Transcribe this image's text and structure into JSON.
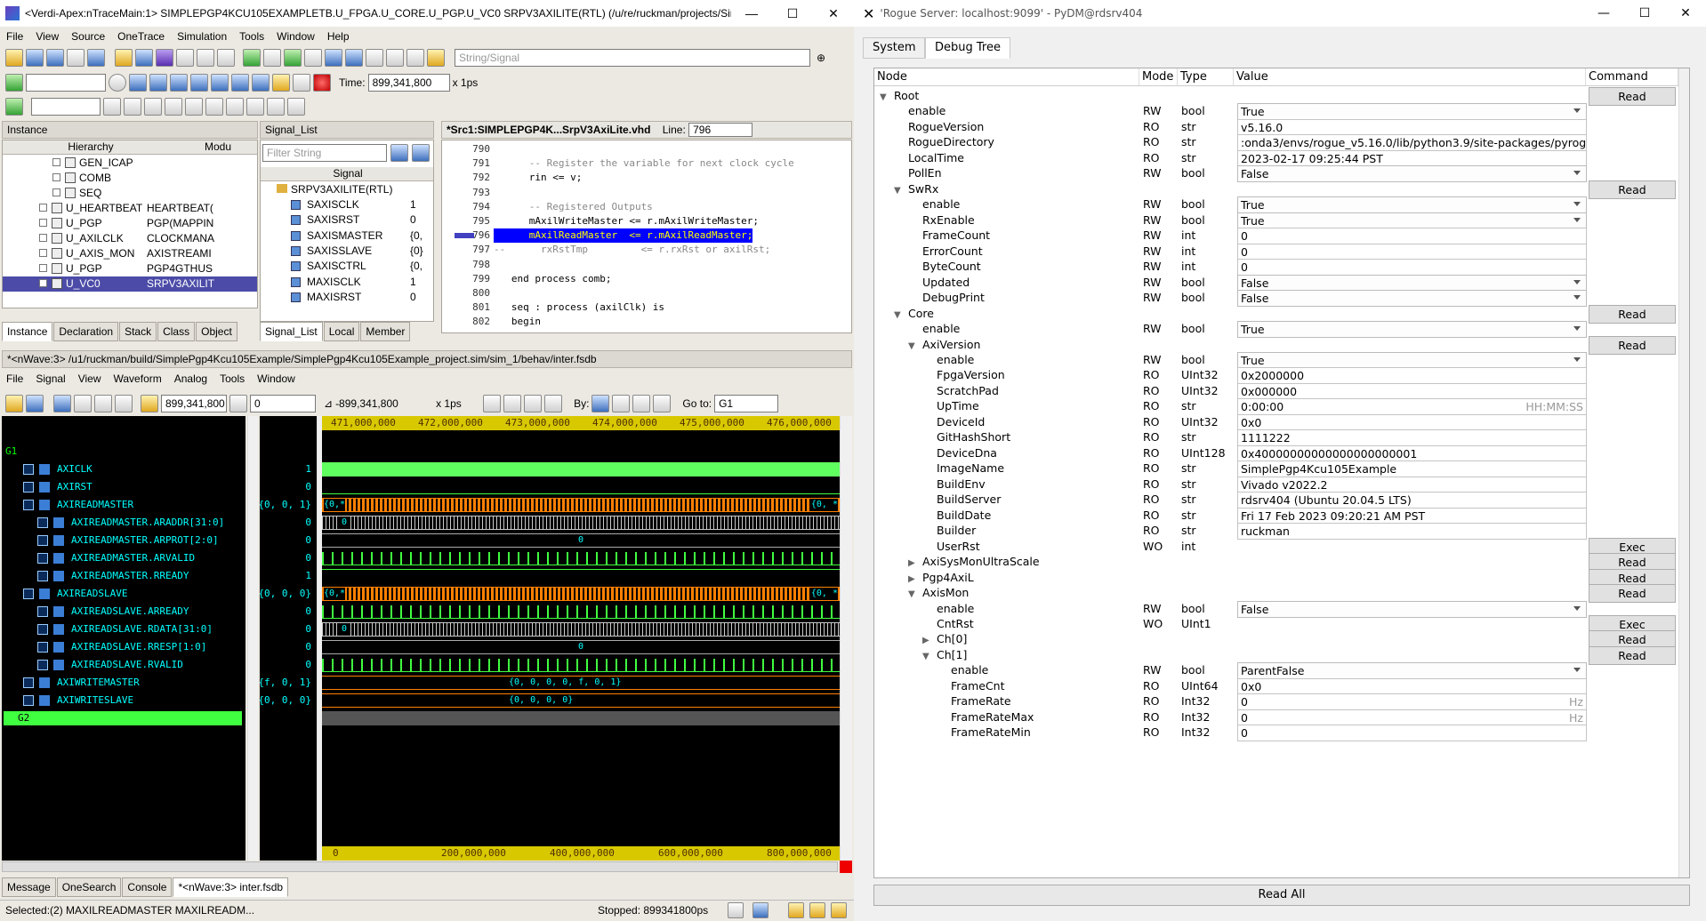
{
  "verdi": {
    "title": "<Verdi-Apex:nTraceMain:1> SIMPLEPGP4KCU105EXAMPLETB.U_FPGA.U_CORE.U_PGP.U_VC0 SRPV3AXILITE(RTL) (/u/re/ruckman/projects/Simple-P...",
    "menu": [
      "File",
      "View",
      "Source",
      "OneTrace",
      "Simulation",
      "Tools",
      "Window",
      "Help"
    ],
    "search_placeholder": "String/Signal",
    "time_label": "Time:",
    "time_value": "899,341,800",
    "time_unit": "x 1ps",
    "instance_panel": "Instance",
    "hier_col": "Hierarchy",
    "mod_col": "Modu",
    "instance_rows": [
      {
        "name": "GEN_ICAP",
        "mod": ""
      },
      {
        "name": "COMB",
        "mod": ""
      },
      {
        "name": "SEQ",
        "mod": ""
      },
      {
        "name": "U_HEARTBEAT",
        "mod": "HEARTBEAT("
      },
      {
        "name": "U_PGP",
        "mod": "PGP(MAPPIN"
      },
      {
        "name": "U_AXILCLK",
        "mod": "CLOCKMANA"
      },
      {
        "name": "U_AXIS_MON",
        "mod": "AXISTREAMI"
      },
      {
        "name": "U_PGP",
        "mod": "PGP4GTHUS"
      },
      {
        "name": "U_VC0",
        "mod": "SRPV3AXILIT"
      }
    ],
    "left_tabs": [
      "Instance",
      "Declaration",
      "Stack",
      "Class",
      "Object"
    ],
    "signal_panel": "Signal_List",
    "filter_placeholder": "Filter String",
    "signal_col": "Signal",
    "signal_root": "SRPV3AXILITE(RTL)",
    "signal_rows": [
      {
        "name": "SAXISCLK",
        "v": "1"
      },
      {
        "name": "SAXISRST",
        "v": "0"
      },
      {
        "name": "SAXISMASTER",
        "v": "{0,"
      },
      {
        "name": "SAXISSLAVE",
        "v": "{0}"
      },
      {
        "name": "SAXISCTRL",
        "v": "{0,"
      },
      {
        "name": "MAXISCLK",
        "v": "1"
      },
      {
        "name": "MAXISRST",
        "v": "0"
      }
    ],
    "signal_tabs": [
      "Signal_List",
      "Local",
      "Member"
    ],
    "src_title": "*Src1:SIMPLEPGP4K...SrpV3AxiLite.vhd",
    "line_label": "Line:",
    "line_value": "796",
    "code": [
      {
        "n": "790",
        "t": ""
      },
      {
        "n": "791",
        "t": "      -- Register the variable for next clock cycle"
      },
      {
        "n": "792",
        "t": "      rin <= v;"
      },
      {
        "n": "793",
        "t": ""
      },
      {
        "n": "794",
        "t": "      -- Registered Outputs"
      },
      {
        "n": "795",
        "t": "      mAxilWriteMaster <= r.mAxilWriteMaster;"
      },
      {
        "n": "796",
        "t": "      mAxilReadMaster  <= r.mAxilReadMaster;"
      },
      {
        "n": "797",
        "t": "--      rxRstTmp         <= r.rxRst or axilRst;"
      },
      {
        "n": "798",
        "t": ""
      },
      {
        "n": "799",
        "t": "   end process comb;"
      },
      {
        "n": "800",
        "t": ""
      },
      {
        "n": "801",
        "t": "   seq : process (axilClk) is"
      },
      {
        "n": "802",
        "t": "   begin"
      }
    ],
    "wave_title": "*<nWave:3> /u1/ruckman/build/SimplePgp4Kcu105Example/SimplePgp4Kcu105Example_project.sim/sim_1/behav/inter.fsdb",
    "wave_menu": [
      "File",
      "Signal",
      "View",
      "Waveform",
      "Analog",
      "Tools",
      "Window"
    ],
    "wave_cursor": "899,341,800",
    "wave_marker": "0",
    "wave_delta": "-899,341,800",
    "wave_unit": "x 1ps",
    "by_label": "By:",
    "goto_label": "Go to:",
    "goto_value": "G1",
    "group1": "G1",
    "group2": "G2",
    "signals": [
      {
        "name": "AXICLK",
        "val": "1",
        "sub": false
      },
      {
        "name": "AXIRST",
        "val": "0",
        "sub": false
      },
      {
        "name": "AXIREADMASTER",
        "val": "{0, 0, 1}",
        "sub": false
      },
      {
        "name": "AXIREADMASTER.ARADDR[31:0]",
        "val": "0",
        "sub": true
      },
      {
        "name": "AXIREADMASTER.ARPROT[2:0]",
        "val": "0",
        "sub": true
      },
      {
        "name": "AXIREADMASTER.ARVALID",
        "val": "0",
        "sub": true
      },
      {
        "name": "AXIREADMASTER.RREADY",
        "val": "1",
        "sub": true
      },
      {
        "name": "AXIREADSLAVE",
        "val": "{0, 0, 0}",
        "sub": false
      },
      {
        "name": "AXIREADSLAVE.ARREADY",
        "val": "0",
        "sub": true
      },
      {
        "name": "AXIREADSLAVE.RDATA[31:0]",
        "val": "0",
        "sub": true
      },
      {
        "name": "AXIREADSLAVE.RRESP[1:0]",
        "val": "0",
        "sub": true
      },
      {
        "name": "AXIREADSLAVE.RVALID",
        "val": "0",
        "sub": true
      },
      {
        "name": "AXIWRITEMASTER",
        "val": "{f, 0, 1}",
        "sub": false
      },
      {
        "name": "AXIWRITESLAVE",
        "val": "{0, 0, 0}",
        "sub": false
      }
    ],
    "wave_labels": {
      "bus1": "{0,*",
      "bus1r": "{0, *",
      "zero": "0",
      "wm": "{0, 0, 0, 0, f, 0, 1}",
      "ws": "{0, 0, 0, 0}"
    },
    "ticks_top": [
      "471,000,000",
      "472,000,000",
      "473,000,000",
      "474,000,000",
      "475,000,000",
      "476,000,000"
    ],
    "ticks_bottom": [
      "0",
      "200,000,000",
      "400,000,000",
      "600,000,000",
      "800,000,000"
    ],
    "bottom_tabs": [
      "Message",
      "OneSearch",
      "Console",
      "*<nWave:3> inter.fsdb"
    ],
    "status_left": "Selected:(2) MAXILREADMASTER MAXILREADM...",
    "status_right": "Stopped:  899341800ps"
  },
  "rogue": {
    "title": "'Rogue Server: localhost:9099' - PyDM@rdsrv404",
    "tabs": [
      "System",
      "Debug Tree"
    ],
    "cols": [
      "Node",
      "Mode",
      "Type",
      "Value",
      "Command"
    ],
    "read_all": "Read All",
    "rows": [
      {
        "ind": 0,
        "arrow": "down",
        "name": "Root",
        "btn": "Read"
      },
      {
        "ind": 1,
        "name": "enable",
        "mode": "RW",
        "type": "bool",
        "val": "True",
        "dd": true
      },
      {
        "ind": 1,
        "name": "RogueVersion",
        "mode": "RO",
        "type": "str",
        "val": "v5.16.0"
      },
      {
        "ind": 1,
        "name": "RogueDirectory",
        "mode": "RO",
        "type": "str",
        "val": ":onda3/envs/rogue_v5.16.0/lib/python3.9/site-packages/pyrogue"
      },
      {
        "ind": 1,
        "name": "LocalTime",
        "mode": "RO",
        "type": "str",
        "val": "2023-02-17 09:25:44 PST"
      },
      {
        "ind": 1,
        "name": "PollEn",
        "mode": "RW",
        "type": "bool",
        "val": "False",
        "dd": true
      },
      {
        "ind": 1,
        "arrow": "down",
        "name": "SwRx",
        "btn": "Read"
      },
      {
        "ind": 2,
        "name": "enable",
        "mode": "RW",
        "type": "bool",
        "val": "True",
        "dd": true
      },
      {
        "ind": 2,
        "name": "RxEnable",
        "mode": "RW",
        "type": "bool",
        "val": "True",
        "dd": true
      },
      {
        "ind": 2,
        "name": "FrameCount",
        "mode": "RW",
        "type": "int",
        "val": "0"
      },
      {
        "ind": 2,
        "name": "ErrorCount",
        "mode": "RW",
        "type": "int",
        "val": "0"
      },
      {
        "ind": 2,
        "name": "ByteCount",
        "mode": "RW",
        "type": "int",
        "val": "0"
      },
      {
        "ind": 2,
        "name": "Updated",
        "mode": "RW",
        "type": "bool",
        "val": "False",
        "dd": true
      },
      {
        "ind": 2,
        "name": "DebugPrint",
        "mode": "RW",
        "type": "bool",
        "val": "False",
        "dd": true
      },
      {
        "ind": 1,
        "arrow": "down",
        "name": "Core",
        "btn": "Read"
      },
      {
        "ind": 2,
        "name": "enable",
        "mode": "RW",
        "type": "bool",
        "val": "True",
        "dd": true
      },
      {
        "ind": 2,
        "arrow": "down",
        "name": "AxiVersion",
        "btn": "Read"
      },
      {
        "ind": 3,
        "name": "enable",
        "mode": "RW",
        "type": "bool",
        "val": "True",
        "dd": true
      },
      {
        "ind": 3,
        "name": "FpgaVersion",
        "mode": "RO",
        "type": "UInt32",
        "val": "0x2000000"
      },
      {
        "ind": 3,
        "name": "ScratchPad",
        "mode": "RO",
        "type": "UInt32",
        "val": "0x000000"
      },
      {
        "ind": 3,
        "name": "UpTime",
        "mode": "RO",
        "type": "str",
        "val": "0:00:00",
        "unit": "HH:MM:SS"
      },
      {
        "ind": 3,
        "name": "DeviceId",
        "mode": "RO",
        "type": "UInt32",
        "val": "0x0"
      },
      {
        "ind": 3,
        "name": "GitHashShort",
        "mode": "RO",
        "type": "str",
        "val": "1111222"
      },
      {
        "ind": 3,
        "name": "DeviceDna",
        "mode": "RO",
        "type": "UInt128",
        "val": "0x40000000000000000000001"
      },
      {
        "ind": 3,
        "name": "ImageName",
        "mode": "RO",
        "type": "str",
        "val": "SimplePgp4Kcu105Example"
      },
      {
        "ind": 3,
        "name": "BuildEnv",
        "mode": "RO",
        "type": "str",
        "val": "Vivado v2022.2"
      },
      {
        "ind": 3,
        "name": "BuildServer",
        "mode": "RO",
        "type": "str",
        "val": "rdsrv404 (Ubuntu 20.04.5 LTS)"
      },
      {
        "ind": 3,
        "name": "BuildDate",
        "mode": "RO",
        "type": "str",
        "val": "Fri 17 Feb 2023 09:20:21 AM PST"
      },
      {
        "ind": 3,
        "name": "Builder",
        "mode": "RO",
        "type": "str",
        "val": "ruckman"
      },
      {
        "ind": 3,
        "name": "UserRst",
        "mode": "WO",
        "type": "int",
        "btn": "Exec"
      },
      {
        "ind": 2,
        "arrow": "right",
        "name": "AxiSysMonUltraScale",
        "btn": "Read"
      },
      {
        "ind": 2,
        "arrow": "right",
        "name": "Pgp4AxiL",
        "btn": "Read"
      },
      {
        "ind": 2,
        "arrow": "down",
        "name": "AxisMon",
        "btn": "Read"
      },
      {
        "ind": 3,
        "name": "enable",
        "mode": "RW",
        "type": "bool",
        "val": "False",
        "dd": true
      },
      {
        "ind": 3,
        "name": "CntRst",
        "mode": "WO",
        "type": "UInt1",
        "btn": "Exec"
      },
      {
        "ind": 3,
        "arrow": "right",
        "name": "Ch[0]",
        "btn": "Read"
      },
      {
        "ind": 3,
        "arrow": "down",
        "name": "Ch[1]",
        "btn": "Read"
      },
      {
        "ind": 4,
        "name": "enable",
        "mode": "RW",
        "type": "bool",
        "val": "ParentFalse",
        "dd": true
      },
      {
        "ind": 4,
        "name": "FrameCnt",
        "mode": "RO",
        "type": "UInt64",
        "val": "0x0"
      },
      {
        "ind": 4,
        "name": "FrameRate",
        "mode": "RO",
        "type": "Int32",
        "val": "0",
        "unit": "Hz"
      },
      {
        "ind": 4,
        "name": "FrameRateMax",
        "mode": "RO",
        "type": "Int32",
        "val": "0",
        "unit": "Hz"
      },
      {
        "ind": 4,
        "name": "FrameRateMin",
        "mode": "RO",
        "type": "Int32",
        "val": "0"
      }
    ]
  }
}
